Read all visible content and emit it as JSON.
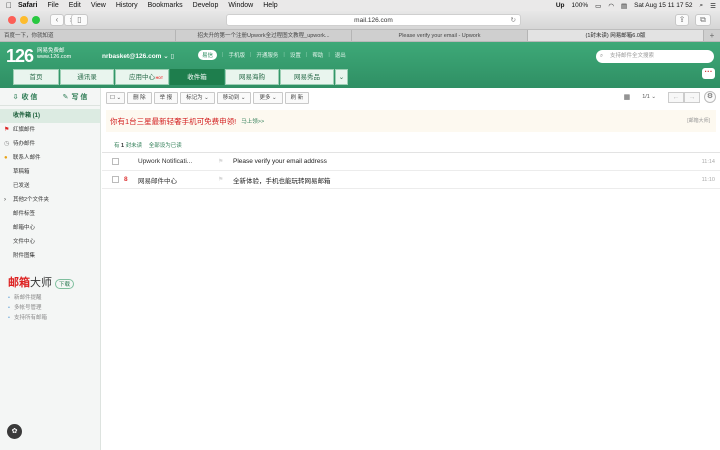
{
  "menubar": {
    "apple": "",
    "items": [
      "Safari",
      "File",
      "Edit",
      "View",
      "History",
      "Bookmarks",
      "Develop",
      "Window",
      "Help"
    ],
    "battery": "100%",
    "datetime": "Sat Aug 15  11 17 52"
  },
  "browser": {
    "url": "mail.126.com",
    "tabs": [
      {
        "label": "百度一下，你就知道"
      },
      {
        "label": "招夫升的第一个注册Upwork全过程图文教程_upwork..."
      },
      {
        "label": "Please verify your email - Upwork"
      },
      {
        "label": "(1封未读) 网易邮箱6.0版"
      }
    ]
  },
  "mail_header": {
    "logo": "126",
    "logo_sub1": "网易免费邮",
    "logo_sub2": "www.126.com",
    "account": "nrbasket@126.com",
    "links": [
      "易信",
      "手机版",
      "开通服务",
      "设置",
      "帮助",
      "退出"
    ],
    "search_placeholder": "支持邮件全文搜索",
    "nav_tabs": [
      "首页",
      "通讯录",
      "应用中心",
      "收件箱",
      "网易海购",
      "网易秀品"
    ],
    "nav_hot": "HOT"
  },
  "sidebar": {
    "receive": "收 信",
    "compose": "写 信",
    "items": [
      {
        "label": "收件箱 (1)"
      },
      {
        "label": "红旗邮件"
      },
      {
        "label": "待办邮件"
      },
      {
        "label": "联系人邮件"
      },
      {
        "label": "草稿箱"
      },
      {
        "label": "已发送"
      },
      {
        "label": "其他2个文件夹"
      },
      {
        "label": "邮件标签"
      },
      {
        "label": "邮箱中心"
      },
      {
        "label": "文件中心"
      },
      {
        "label": "附件图集"
      }
    ],
    "promo_brand": "邮箱",
    "promo_brand2": "大师",
    "promo_download": "下载",
    "promo_features": [
      "新邮件提醒",
      "多帐号管理",
      "支持所有邮箱"
    ]
  },
  "actions": {
    "buttons": [
      "删 除",
      "举 报",
      "标记为",
      "移动到",
      "更多",
      "刷 新"
    ],
    "page": "1/1"
  },
  "banner": {
    "text": "你有1台三星最新轻奢手机可免费申领!",
    "link": "马上领>>",
    "ad": "[邮箱大师]"
  },
  "filter": {
    "prefix": "有",
    "count": "1",
    "unread": "封未读",
    "mark_all": "全部设为已读"
  },
  "messages": [
    {
      "tag": "",
      "from": "Upwork Notificati...",
      "subject": "Please verify your email address",
      "time": "11:14"
    },
    {
      "tag": "8",
      "from": "网易邮件中心",
      "subject": "全新体验，手机也能玩转网易邮箱",
      "time": "11:10"
    }
  ]
}
